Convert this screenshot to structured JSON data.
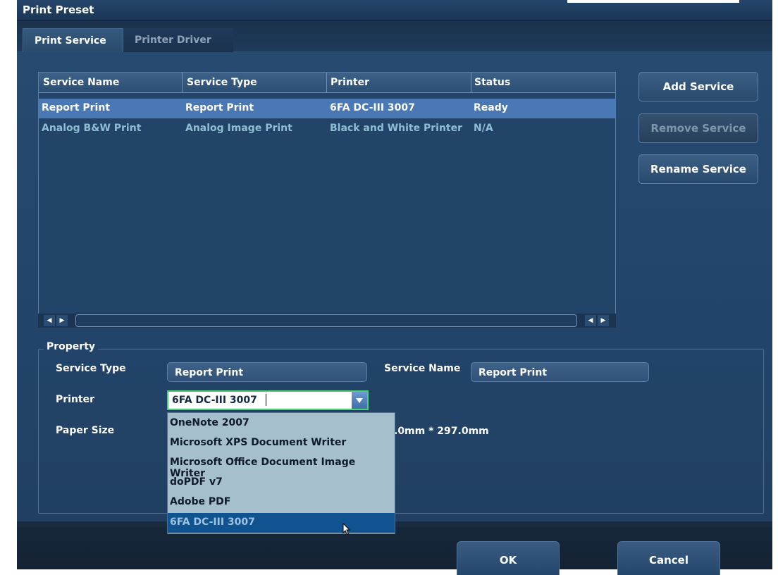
{
  "window": {
    "title": "Print Preset"
  },
  "tabs": [
    {
      "label": "Print Service",
      "active": true
    },
    {
      "label": "Printer Driver",
      "active": false
    }
  ],
  "services_table": {
    "columns": [
      "Service Name",
      "Service Type",
      "Printer",
      "Status"
    ],
    "rows": [
      {
        "service_name": "Report Print",
        "service_type": "Report Print",
        "printer": "6FA DC-III 3007",
        "status": "Ready",
        "selected": true
      },
      {
        "service_name": "Analog B&W Print",
        "service_type": "Analog Image Print",
        "printer": "Black and White Printer",
        "status": "N/A",
        "selected": false
      }
    ]
  },
  "side_buttons": {
    "add": "Add Service",
    "remove": "Remove Service",
    "rename": "Rename Service"
  },
  "property": {
    "legend": "Property",
    "service_type_label": "Service Type",
    "service_type_value": "Report Print",
    "service_name_label": "Service Name",
    "service_name_value": "Report Print",
    "printer_label": "Printer",
    "printer_value": "6FA DC-III 3007",
    "paper_size_label": "Paper Size",
    "paper_size_value": ".0mm * 297.0mm"
  },
  "printer_options": [
    "OneNote 2007",
    "Microsoft XPS Document Writer",
    "Microsoft Office Document Image Writer",
    "doPDF v7",
    "Adobe PDF",
    "6FA DC-III 3007"
  ],
  "footer": {
    "ok": "OK",
    "cancel": "Cancel"
  },
  "colors": {
    "selected_row": "#4a78b5",
    "dim_row_text": "#8fbdd6",
    "combo_focus": "#4fd070",
    "dropdown_bg": "#a6bfcc",
    "dropdown_selected": "#0f5391"
  }
}
